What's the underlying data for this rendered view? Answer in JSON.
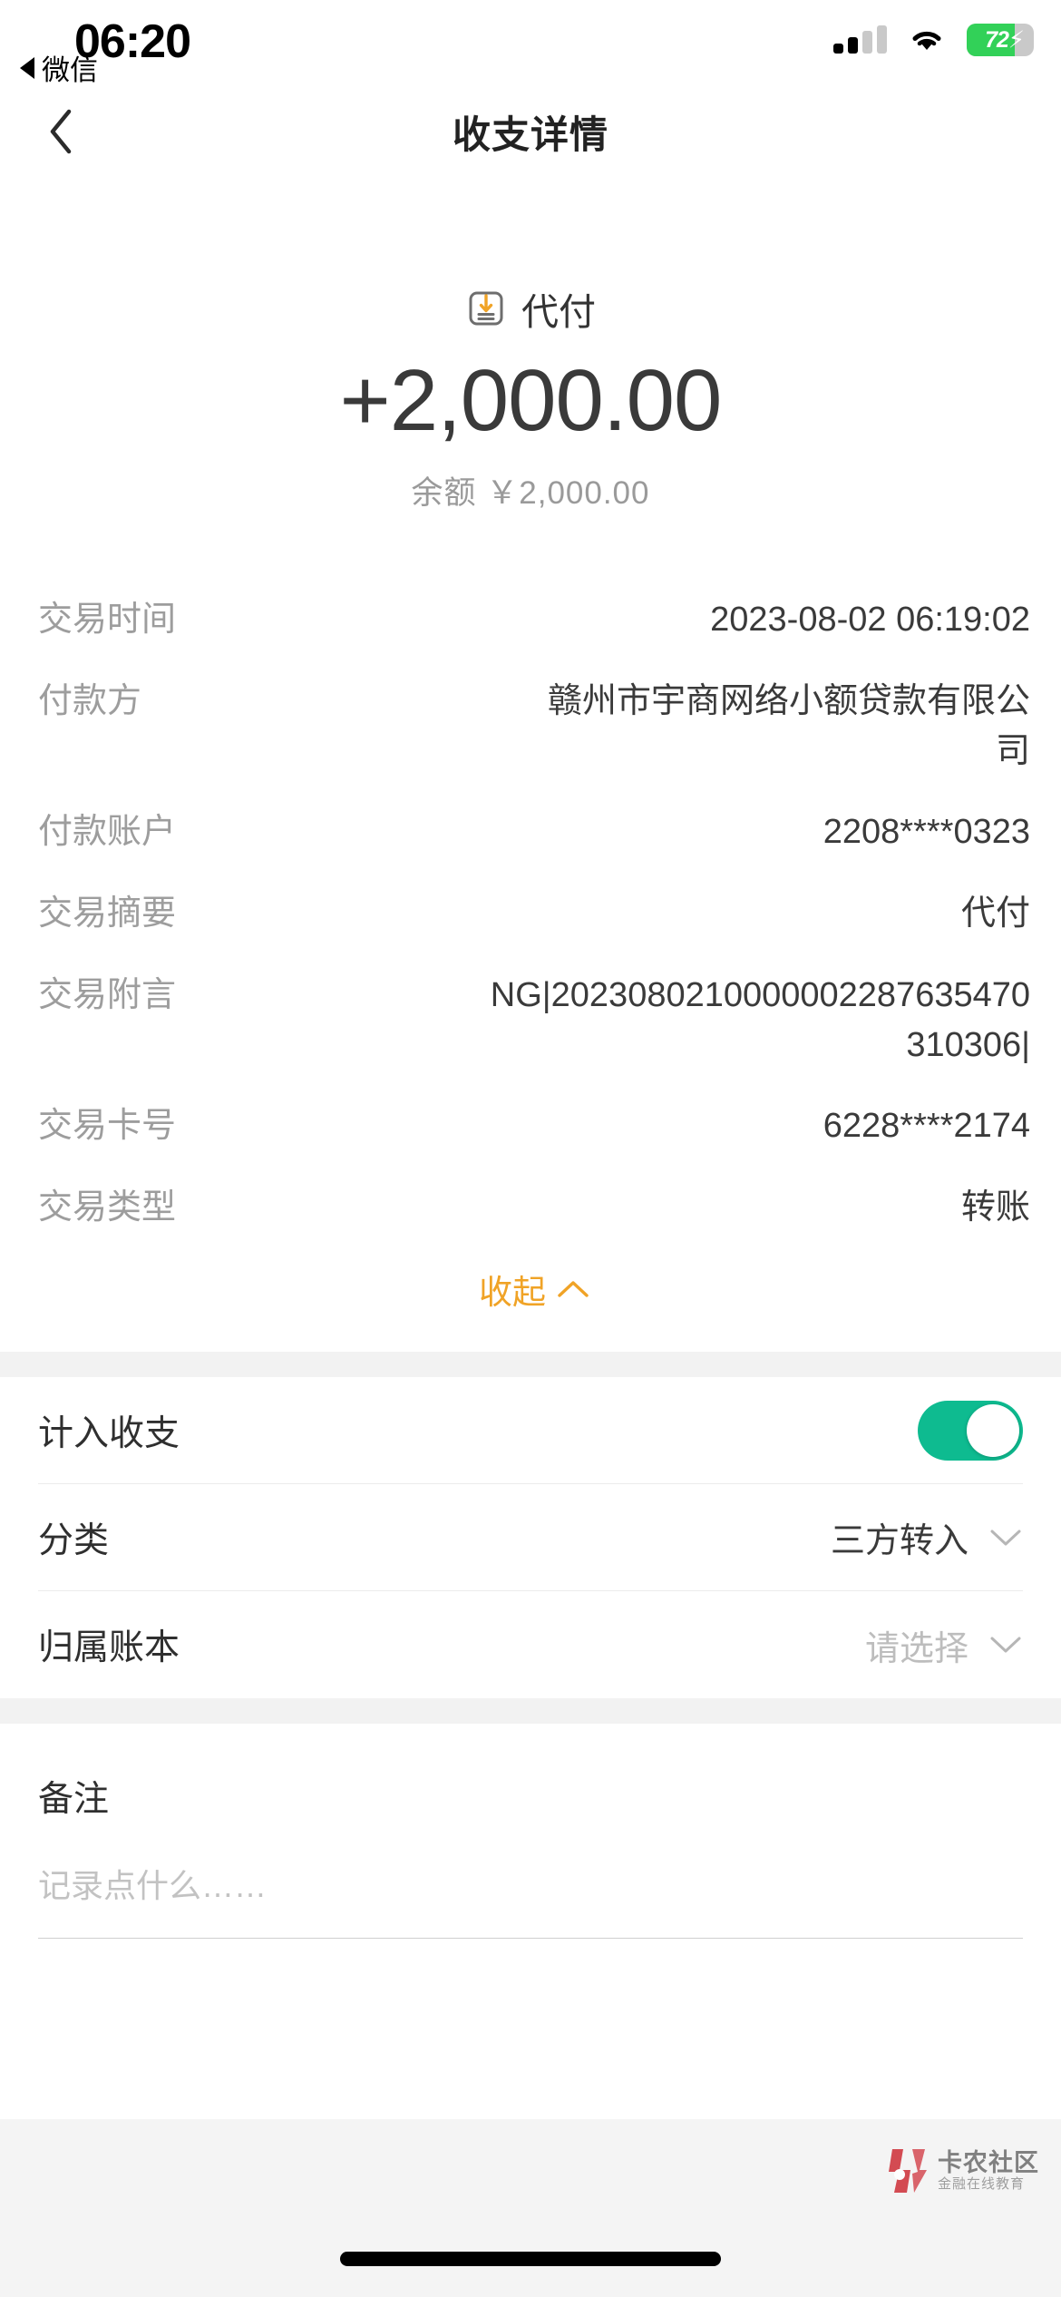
{
  "status_bar": {
    "time": "06:20",
    "return_app_label": "微信",
    "battery_percent": "72",
    "battery_charging": true,
    "battery_color": "#32d158"
  },
  "navbar": {
    "title": "收支详情",
    "back_icon": "chevron-left-icon"
  },
  "summary": {
    "type_icon": "document-download-icon",
    "type_label": "代付",
    "amount": "+2,000.00",
    "balance_label": "余额",
    "balance_value": "￥2,000.00"
  },
  "details": {
    "rows": [
      {
        "label": "交易时间",
        "value": "2023-08-02 06:19:02"
      },
      {
        "label": "付款方",
        "value": "赣州市宇商网络小额贷款有限公司"
      },
      {
        "label": "付款账户",
        "value": "2208****0323"
      },
      {
        "label": "交易摘要",
        "value": "代付"
      },
      {
        "label": "交易附言",
        "value": "NG|2023080210000002287635470310306|"
      },
      {
        "label": "交易卡号",
        "value": "6228****2174"
      },
      {
        "label": "交易类型",
        "value": "转账"
      }
    ],
    "collapse_label": "收起",
    "collapse_icon": "chevron-up-icon",
    "collapse_color": "#f0a326"
  },
  "settings": {
    "include_label": "计入收支",
    "include_enabled": true,
    "toggle_on_color": "#0ebb90",
    "category_label": "分类",
    "category_value": "三方转入",
    "book_label": "归属账本",
    "book_placeholder": "请选择",
    "chevron_icon": "chevron-down-icon"
  },
  "remarks": {
    "title": "备注",
    "placeholder": "记录点什么……"
  },
  "watermark": {
    "name": "卡农社区",
    "tagline": "金融在线教育",
    "logo_color": "#d2424a"
  }
}
